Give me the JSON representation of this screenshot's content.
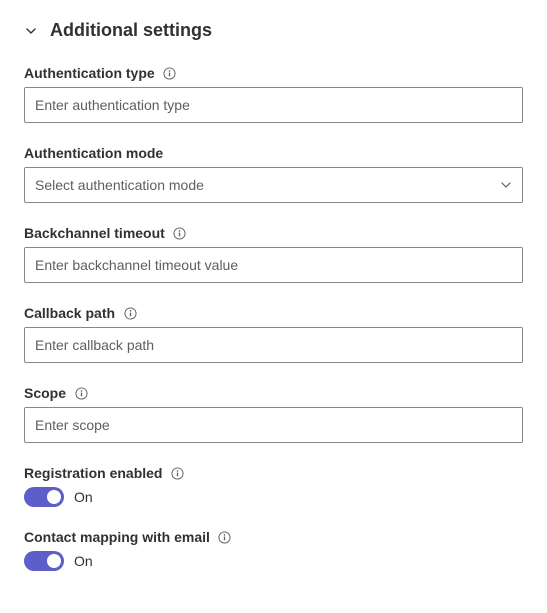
{
  "section": {
    "title": "Additional settings"
  },
  "fields": {
    "auth_type": {
      "label": "Authentication type",
      "placeholder": "Enter authentication type",
      "value": ""
    },
    "auth_mode": {
      "label": "Authentication mode",
      "placeholder": "Select authentication mode",
      "value": ""
    },
    "backchannel_timeout": {
      "label": "Backchannel timeout",
      "placeholder": "Enter backchannel timeout value",
      "value": ""
    },
    "callback_path": {
      "label": "Callback path",
      "placeholder": "Enter callback path",
      "value": ""
    },
    "scope": {
      "label": "Scope",
      "placeholder": "Enter scope",
      "value": ""
    },
    "registration_enabled": {
      "label": "Registration enabled",
      "state": "On"
    },
    "contact_mapping_email": {
      "label": "Contact mapping with email",
      "state": "On"
    }
  }
}
